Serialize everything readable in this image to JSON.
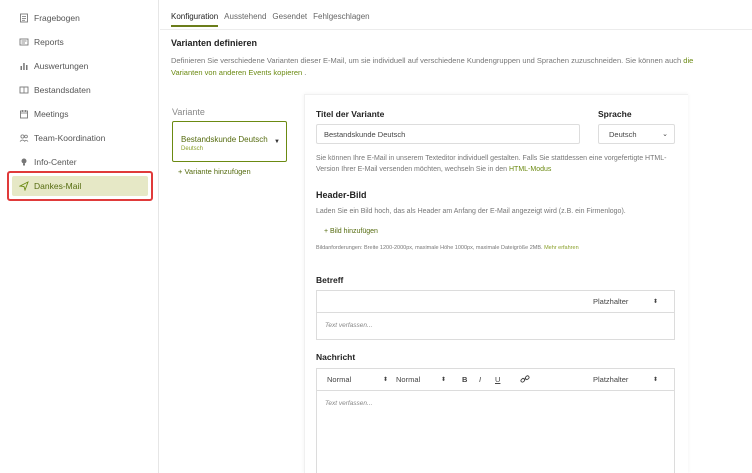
{
  "sidebar": {
    "items": [
      {
        "label": "Fragebogen",
        "icon": "form-icon"
      },
      {
        "label": "Reports",
        "icon": "reports-icon"
      },
      {
        "label": "Auswertungen",
        "icon": "bar-chart-icon"
      },
      {
        "label": "Bestandsdaten",
        "icon": "book-icon"
      },
      {
        "label": "Meetings",
        "icon": "calendar-icon"
      },
      {
        "label": "Team-Koordination",
        "icon": "team-icon"
      },
      {
        "label": "Info-Center",
        "icon": "bulb-icon"
      },
      {
        "label": "Dankes-Mail",
        "icon": "send-icon",
        "active": true
      }
    ],
    "active_color": "#e6e8c6",
    "highlight_border": "#e03a3a"
  },
  "tabs": [
    "Konfiguration",
    "Ausstehend",
    "Gesendet",
    "Fehlgeschlagen"
  ],
  "main": {
    "section_title": "Varianten definieren",
    "description_prefix": "Definieren Sie verschiedene Varianten dieser E-Mail, um sie individuell auf verschiedene Kundengruppen und Sprachen zuzuschneiden. Sie können auch ",
    "description_link": "die Varianten von anderen Events kopieren",
    "description_suffix": " .",
    "variant_label": "Variante",
    "variant_card": {
      "name": "Bestandskunde Deutsch",
      "sub": "Deutsch"
    },
    "add_variant": "+ Variante hinzufügen"
  },
  "panel": {
    "title_label": "Titel der Variante",
    "title_value": "Bestandskunde Deutsch",
    "language_label": "Sprache",
    "language_value": "Deutsch",
    "editor_info_prefix": "Sie können Ihre E-Mail in unserem Texteditor individuell gestalten. Falls Sie stattdessen eine vorgefertigte HTML-Version Ihrer E-Mail versenden möchten, wechseln Sie in den ",
    "editor_info_link": "HTML-Modus",
    "header_label": "Header-Bild",
    "header_info": "Laden Sie ein Bild hoch, das als Header am Anfang der E-Mail angezeigt wird (z.B. ein Firmenlogo).",
    "add_image": "+ Bild hinzufügen",
    "image_req": "Bildanforderungen: Breite 1200-2000px, maximale Höhe 1000px, maximale Dateigröße 2MB.",
    "image_req_link": "Mehr erfahren",
    "subject_label": "Betreff",
    "placeholder_select": "Platzhalter",
    "subject_placeholder": "Text verfassen...",
    "message_label": "Nachricht",
    "format1": "Normal",
    "format2": "Normal",
    "bold": "B",
    "italic": "I",
    "underline": "U",
    "message_placeholder": "Text verfassen..."
  },
  "colors": {
    "accent": "#6b8a12",
    "accent_dark": "#556b0f"
  }
}
